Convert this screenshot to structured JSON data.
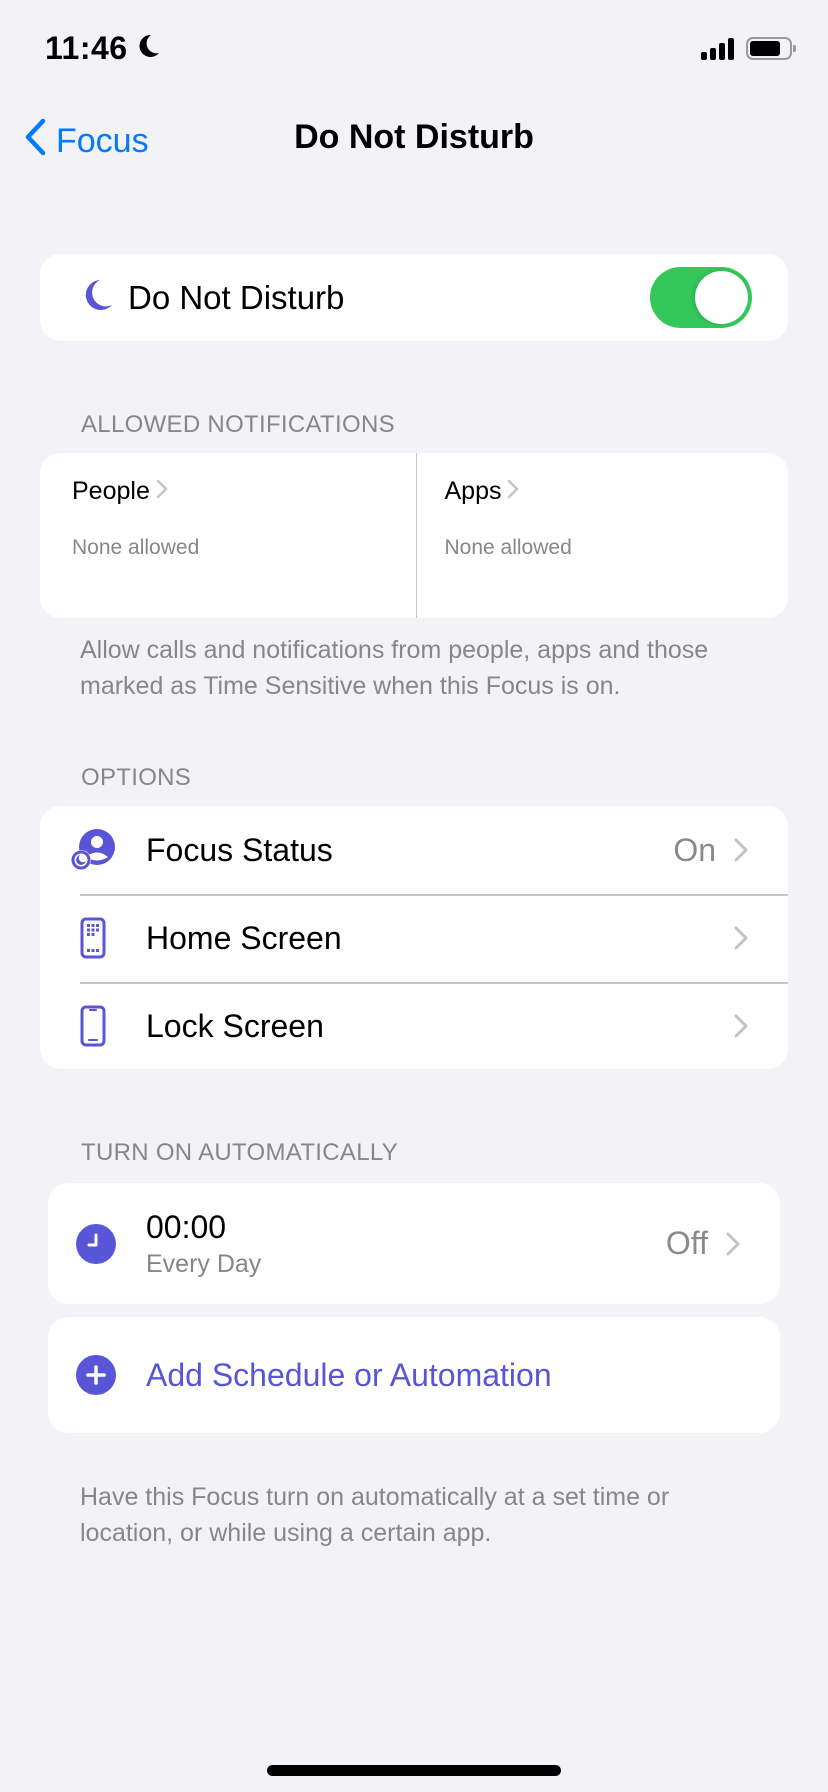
{
  "status_bar": {
    "time": "11:46",
    "focus_icon": "moon-icon",
    "signal_bars": 4,
    "battery_level_percent": 80
  },
  "nav": {
    "back_label": "Focus",
    "title": "Do Not Disturb"
  },
  "focus_toggle": {
    "icon": "moon-icon",
    "label": "Do Not Disturb",
    "enabled": true
  },
  "allowed_notifications": {
    "header": "ALLOWED NOTIFICATIONS",
    "people": {
      "label": "People",
      "value": "None allowed"
    },
    "apps": {
      "label": "Apps",
      "value": "None allowed"
    },
    "footer": "Allow calls and notifications from people, apps and those marked as Time Sensitive when this Focus is on."
  },
  "options": {
    "header": "OPTIONS",
    "items": [
      {
        "icon": "focus-status-icon",
        "label": "Focus Status",
        "value": "On"
      },
      {
        "icon": "home-screen-icon",
        "label": "Home Screen",
        "value": ""
      },
      {
        "icon": "lock-screen-icon",
        "label": "Lock Screen",
        "value": ""
      }
    ]
  },
  "automation": {
    "header": "TURN ON AUTOMATICALLY",
    "schedules": [
      {
        "icon": "clock-icon",
        "time": "00:00",
        "days": "Every Day",
        "status": "Off"
      }
    ],
    "add_label": "Add Schedule or Automation",
    "footer": "Have this Focus turn on automatically at a set time or location, or while using a certain app."
  },
  "colors": {
    "accent": "#5856D6",
    "link": "#007AFF",
    "toggle_on": "#34C759",
    "background": "#F2F2F7",
    "secondary_text": "#86868B"
  }
}
